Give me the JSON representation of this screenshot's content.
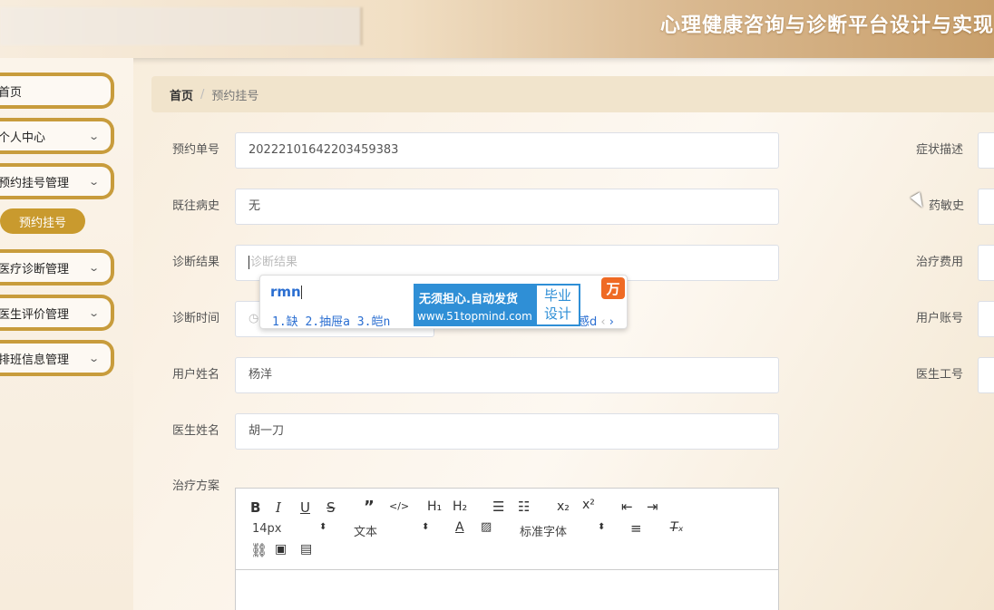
{
  "header": {
    "title": "心理健康咨询与诊断平台设计与实现"
  },
  "sidebar": {
    "items": [
      {
        "label": "首页"
      },
      {
        "label": "个人中心"
      },
      {
        "label": "预约挂号管理"
      },
      {
        "label": "医疗诊断管理"
      },
      {
        "label": "医生评价管理"
      },
      {
        "label": "排班信息管理"
      }
    ],
    "sub_item": "预约挂号",
    "chevron": "⌄"
  },
  "breadcrumb": {
    "home": "首页",
    "separator": "/",
    "current": "预约挂号"
  },
  "form": {
    "left": [
      {
        "label": "预约单号",
        "value": "20222101642203459383"
      },
      {
        "label": "既往病史",
        "value": "无"
      },
      {
        "label": "诊断结果",
        "placeholder": "诊断结果"
      },
      {
        "label": "诊断时间"
      },
      {
        "label": "用户姓名",
        "value": "杨洋"
      },
      {
        "label": "医生姓名",
        "value": "胡一刀"
      },
      {
        "label": "治疗方案"
      }
    ],
    "right": [
      {
        "label": "症状描述"
      },
      {
        "label": "药敏史"
      },
      {
        "label": "治疗费用"
      },
      {
        "label": "用户账号"
      },
      {
        "label": "医生工号"
      }
    ]
  },
  "editor": {
    "font_size": "14px",
    "block_type": "文本",
    "font_family": "标准字体"
  },
  "ime": {
    "typed": "rmn",
    "candidates": "1.缺  2.抽屉a  3.皑n",
    "tail": "感d",
    "ad_line1": "无须担心.自动发货",
    "ad_line2": "www.51topmind.com",
    "ad_badge_1": "毕业",
    "ad_badge_2": "设计"
  }
}
